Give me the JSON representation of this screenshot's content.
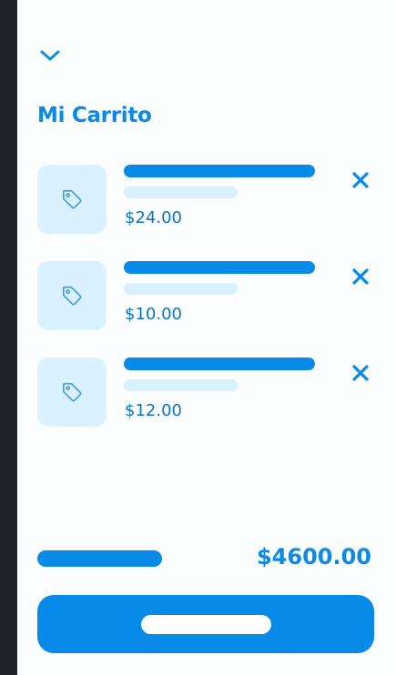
{
  "cart": {
    "title": "Mi Carrito",
    "items": [
      {
        "price": "$24.00",
        "icon": "tag-icon"
      },
      {
        "price": "$10.00",
        "icon": "tag-icon"
      },
      {
        "price": "$12.00",
        "icon": "tag-icon"
      }
    ],
    "total": "$4600.00"
  },
  "icons": {
    "collapse": "chevron-down-icon",
    "remove": "close-icon"
  },
  "colors": {
    "accent": "#078ae8",
    "accent_light": "#daf2fd",
    "price_text": "#0a74c8",
    "background": "#fcfdff",
    "frame": "#1f2228"
  }
}
